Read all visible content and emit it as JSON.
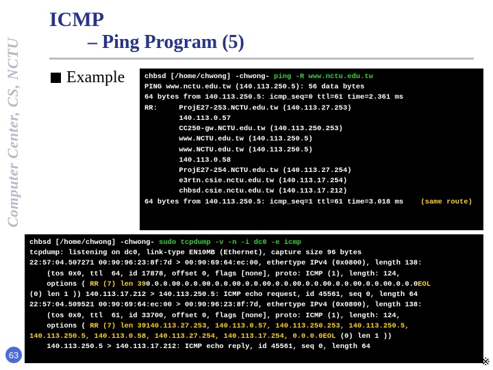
{
  "sidebar": "Computer Center, CS, NCTU",
  "page_number": "63",
  "title": {
    "line1": "ICMP",
    "line2": "– Ping Program (5)"
  },
  "bullet": "Example",
  "term1": {
    "prompt": "chbsd [/home/chwong] -chwong- ",
    "cmd": "ping -R www.nctu.edu.tw",
    "l1": "PING www.nctu.edu.tw (140.113.250.5): 56 data bytes",
    "l2": "64 bytes from 140.113.250.5: icmp_seq=0 ttl=61 time=2.361 ms",
    "l3": "RR:     ProjE27-253.NCTU.edu.tw (140.113.27.253)",
    "l4": "        140.113.0.57",
    "l5": "        CC250-gw.NCTU.edu.tw (140.113.250.253)",
    "l6": "        www.NCTU.edu.tw (140.113.250.5)",
    "l7": "        www.NCTU.edu.tw (140.113.250.5)",
    "l8": "        140.113.0.58",
    "l9": "        ProjE27-254.NCTU.edu.tw (140.113.27.254)",
    "l10": "        e3rtn.csie.nctu.edu.tw (140.113.17.254)",
    "l11": "        chbsd.csie.nctu.edu.tw (140.113.17.212)",
    "l12a": "64 bytes from 140.113.250.5: icmp_seq=1 ttl=61 time=3.018 ms",
    "l12b": "    (same route)"
  },
  "term2": {
    "prompt": "chbsd [/home/chwong] -chwong- ",
    "cmd": "sudo tcpdump -v -n -i dc0 -e icmp",
    "l1": "tcpdump: listening on dc0, link-type EN10MB (Ethernet), capture size 96 bytes",
    "l2": "22:57:04.507271 00:90:96:23:8f:7d > 00:90:69:64:ec:00, ethertype IPv4 (0x0800), length 138:",
    "l3a": "    (tos 0x0, ttl  64, id 17878, offset 0, flags [none], proto: ICMP (1), length: 124,",
    "l3b": "    options ( ",
    "l3rr": "RR (7) len 39",
    "l3c": "0.0.0.00.0.0.00.0.0.00.0.0.00.0.0.00.0.0.00.0.0.00.0.0.00.0.0.0",
    "l3eol": "EOL",
    "l4": "(0) len 1 )) 140.113.17.212 > 140.113.250.5: ICMP echo request, id 45561, seq 0, length 64",
    "l5": "22:57:04.509521 00:90:69:64:ec:00 > 00:90:96:23:8f:7d, ethertype IPv4 (0x0800), length 138:",
    "l6a": "    (tos 0x0, ttl  61, id 33700, offset 0, flags [none], proto: ICMP (1), length: 124,",
    "l6b": "    options ( ",
    "l6rr": "RR (7) len 39",
    "l6c1": "140.113.27.253, 140.113.0.57, 140.113.250.253, 140.113.250.5,",
    "l6c2": "140.113.250.5, 140.113.0.58, 140.113.27.254, 140.113.17.254, 0.0.0.0",
    "l6eol": "EOL",
    "l6d": " (0) len 1 ))",
    "l7": "    140.113.250.5 > 140.113.17.212: ICMP echo reply, id 45561, seq 0, length 64"
  },
  "star": "※"
}
